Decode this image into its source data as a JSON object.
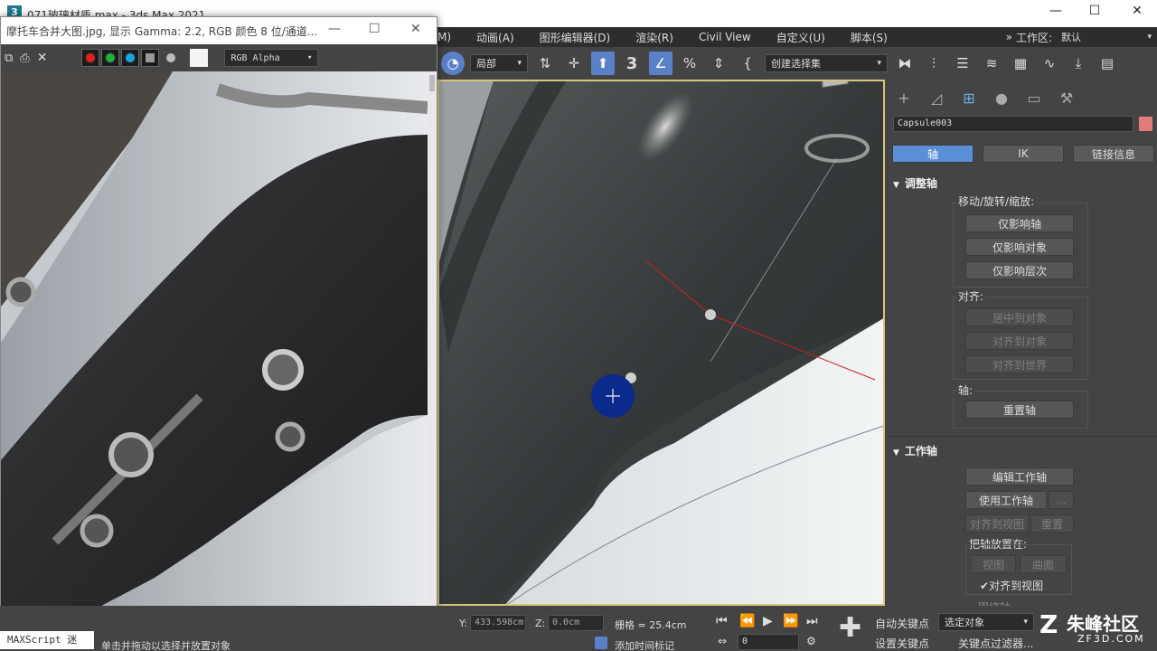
{
  "app": {
    "title": "071玻璃材质.max - 3ds Max 2021",
    "logo_letter": "3",
    "window_controls": {
      "minimize": "—",
      "maximize": "☐",
      "close": "✕"
    }
  },
  "menu": {
    "items": [
      "M)",
      "动画(A)",
      "图形编辑器(D)",
      "渲染(R)",
      "Civil View",
      "自定义(U)",
      "脚本(S)"
    ],
    "overflow": "»",
    "workspace_label": "工作区:",
    "workspace_value": "默认"
  },
  "toolbar": {
    "coord_system": "局部",
    "selection_set": "创建选择集",
    "snap_value": "3"
  },
  "image_window": {
    "title": "摩托车合并大图.jpg, 显示 Gamma: 2.2, RGB 颜色 8 位/通道...",
    "channel": "RGB Alpha",
    "channel_colors": {
      "red": "#e02020",
      "green": "#20b040",
      "blue": "#1aa6e0"
    }
  },
  "command_panel": {
    "object_name": "Capsule003",
    "object_color": "#e47b7b",
    "tabs": {
      "pivot": "轴",
      "ik": "IK",
      "link": "链接信息"
    },
    "adjust_pivot": {
      "title": "调整轴",
      "move_group": "移动/旋转/缩放:",
      "affect_pivot": "仅影响轴",
      "affect_object": "仅影响对象",
      "affect_hierarchy": "仅影响层次",
      "align_group": "对齐:",
      "center_to_object": "居中到对象",
      "align_to_object": "对齐到对象",
      "align_to_world": "对齐到世界",
      "pivot_group": "轴:",
      "reset_pivot": "重置轴"
    },
    "working_pivot": {
      "title": "工作轴",
      "edit_working_pivot": "编辑工作轴",
      "use_working_pivot": "使用工作轴",
      "more": "...",
      "align_to_view": "对齐到视图",
      "reset": "重置",
      "place_pivot_on": "把轴放置在:",
      "view": "视图",
      "surface": "曲面",
      "align_to_view_check": "对齐到视图",
      "next_rollout": "围绕轴"
    }
  },
  "status": {
    "maxscript": "MAXScript 迷",
    "prompt": "单击并拖动以选择并放置对象",
    "y_label": "Y:",
    "y_value": "433.598cm",
    "z_label": "Z:",
    "z_value": "0.0cm",
    "grid": "栅格 = 25.4cm",
    "add_time_tag": "添加时间标记",
    "frame": "0",
    "auto_key": "自动关键点",
    "set_key": "设置关键点",
    "selected_object": "选定对象",
    "key_filters": "关键点过滤器..."
  },
  "watermark": {
    "brand": "朱峰社区",
    "url": "ZF3D.COM"
  }
}
